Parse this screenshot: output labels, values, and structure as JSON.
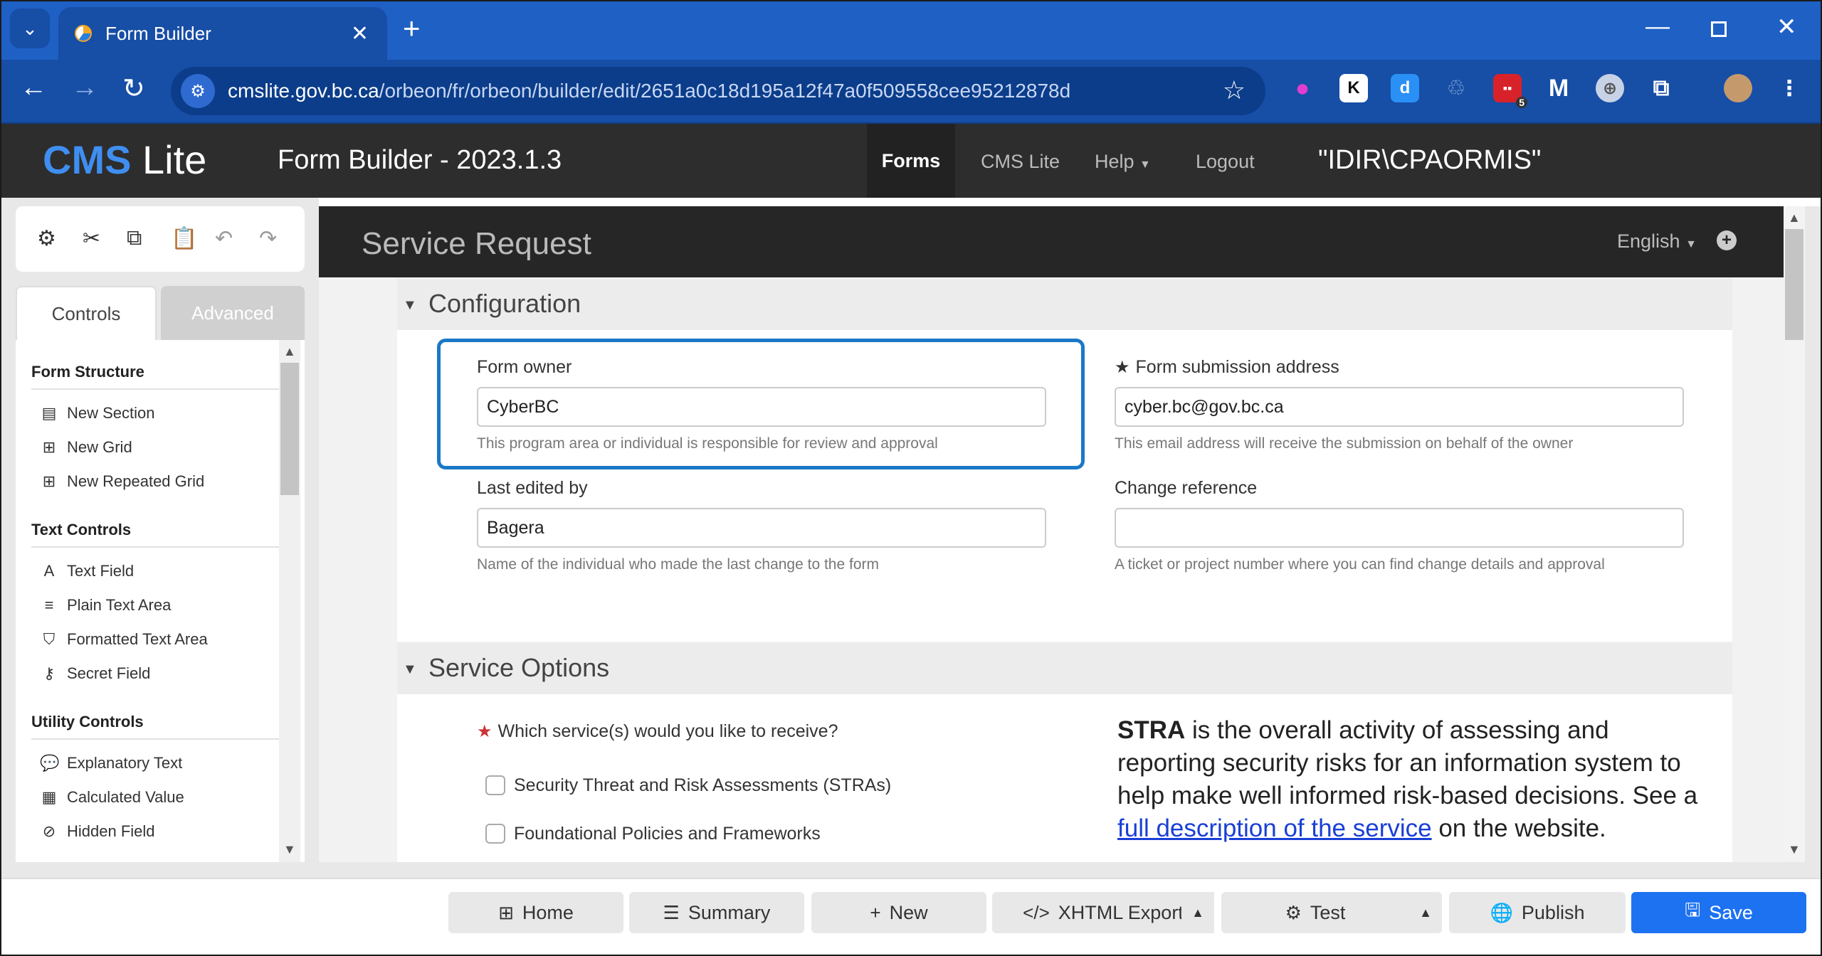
{
  "browser": {
    "tab_title": "Form Builder",
    "url_host": "cmslite.gov.bc.ca",
    "url_path": "/orbeon/fr/orbeon/builder/edit/2651a0c18d195a12f47a0f509558cee95212878d",
    "extension_badge": "5"
  },
  "header": {
    "brand_cms": "CMS",
    "brand_lite": "Lite",
    "subtitle": "Form Builder - 2023.1.3",
    "nav": [
      "Forms",
      "CMS Lite",
      "Help",
      "Logout"
    ],
    "user": "\"IDIR\\CPAORMIS\""
  },
  "sidebar": {
    "tabs": [
      "Controls",
      "Advanced"
    ],
    "groups": [
      {
        "title": "Form Structure",
        "items": [
          "New Section",
          "New Grid",
          "New Repeated Grid"
        ]
      },
      {
        "title": "Text Controls",
        "items": [
          "Text Field",
          "Plain Text Area",
          "Formatted Text Area",
          "Secret Field"
        ]
      },
      {
        "title": "Utility Controls",
        "items": [
          "Explanatory Text",
          "Calculated Value",
          "Hidden Field"
        ]
      }
    ]
  },
  "form": {
    "title": "Service Request",
    "language": "English",
    "sections": [
      {
        "title": "Configuration"
      },
      {
        "title": "Service Options"
      }
    ],
    "fields": {
      "owner_label": "Form owner",
      "owner_value": "CyberBC",
      "owner_help": "This program area or individual is responsible for review and approval",
      "address_label": "Form submission address",
      "address_value": "cyber.bc@gov.bc.ca",
      "address_help": "This email address will receive the submission on behalf of the owner",
      "edited_label": "Last edited by",
      "edited_value": "Bagera",
      "edited_help": "Name of the individual who made the last change to the form",
      "change_label": "Change reference",
      "change_value": "",
      "change_help": "A ticket or project number where you can find change details and approval"
    },
    "service_question": "Which service(s) would you like to receive?",
    "service_options": [
      "Security Threat and Risk Assessments (STRAs)",
      "Foundational Policies and Frameworks"
    ],
    "explanation": {
      "bold": "STRA",
      "text1": " is the overall activity of assessing and reporting security risks for an information system to help make well informed risk-based decisions. See a ",
      "link": "full description of the service",
      "text2": " on the website."
    }
  },
  "bottombar": {
    "buttons": [
      "Home",
      "Summary",
      "New",
      "XHTML Export",
      "Test",
      "Publish",
      "Save"
    ]
  },
  "colors": {
    "chrome_blue": "#1f60c4",
    "app_header": "#2d2d2d",
    "highlight": "#1b78c6",
    "primary_button": "#1d72f2",
    "brand_accent": "#3f8ef0"
  }
}
